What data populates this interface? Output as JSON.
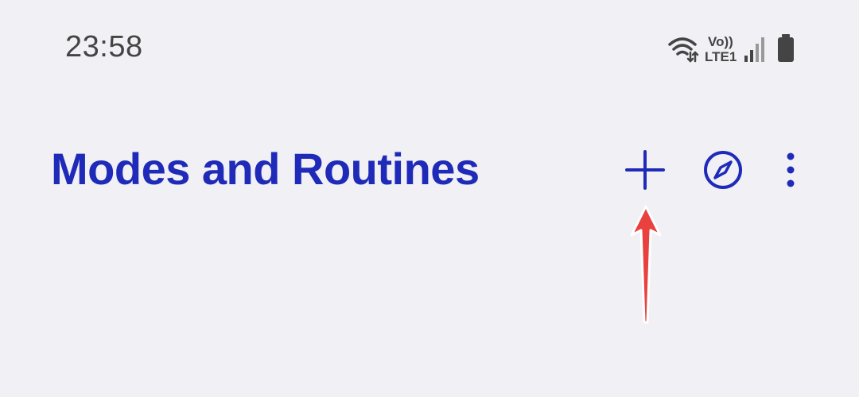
{
  "status_bar": {
    "time": "23:58",
    "network_label_top": "Vo))",
    "network_label_bottom": "LTE1",
    "icons": [
      "wifi-icon",
      "volte-lte-icon",
      "signal-icon",
      "battery-icon"
    ]
  },
  "header": {
    "title": "Modes and Routines",
    "actions": [
      {
        "name": "add",
        "icon": "plus-icon"
      },
      {
        "name": "discover",
        "icon": "compass-icon"
      },
      {
        "name": "more-options",
        "icon": "vertical-dots-icon"
      }
    ]
  },
  "annotation": {
    "type": "arrow",
    "points_to": "add"
  },
  "colors": {
    "background": "#f0f0f5",
    "title": "#1f2bb8",
    "status_text": "#444444",
    "annotation_arrow": "#e8413e"
  }
}
